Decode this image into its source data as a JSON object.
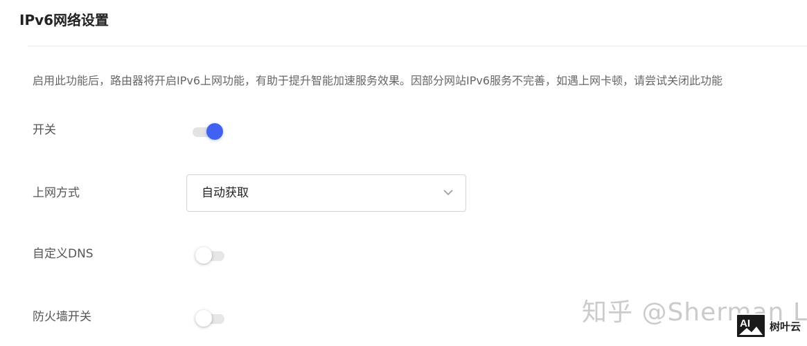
{
  "header": {
    "title": "IPv6网络设置"
  },
  "description": "启用此功能后，路由器将开启IPv6上网功能，有助于提升智能加速服务效果。因部分网站IPv6服务不完善，如遇上网卡顿，请尝试关闭此功能",
  "settings": {
    "switch": {
      "label": "开关",
      "enabled": true
    },
    "connection_type": {
      "label": "上网方式",
      "selected": "自动获取"
    },
    "custom_dns": {
      "label": "自定义DNS",
      "enabled": false
    },
    "firewall": {
      "label": "防火墙开关",
      "enabled": false
    }
  },
  "colors": {
    "accent": "#4162f0"
  },
  "icons": {
    "dropdown": "chevron-down-icon",
    "badge_logo": "ai-image-icon"
  },
  "watermark": {
    "text": "知乎 @Sherman Li",
    "badge_logo_text": "AI",
    "badge_brand": "树叶云"
  }
}
